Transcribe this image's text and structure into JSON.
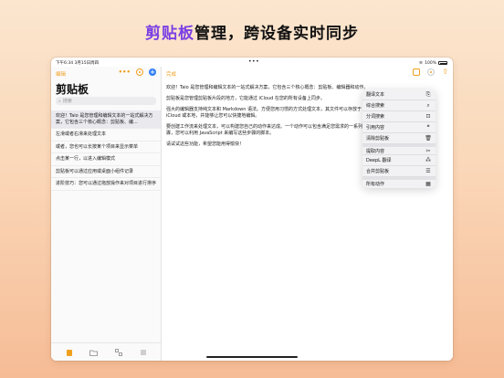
{
  "headline": {
    "highlight": "剪贴板",
    "rest": "管理，跨设备实时同步"
  },
  "status": {
    "time": "下午6:34  3月15日周四",
    "center": "•••",
    "battery": "100%"
  },
  "sidebar": {
    "edit": "编辑",
    "more": "•••",
    "add": "+",
    "title": "剪贴板",
    "search_placeholder": "搜索",
    "items": [
      {
        "text": "欢迎！Taio 是您管理和编辑文本的一站式解决方案，它包含三个核心概念：剪贴板、编..."
      },
      {
        "text": "左滑或者右滑来处理文本"
      },
      {
        "text": "或者，您也可以长按某个项目来显示菜单"
      },
      {
        "text": "点击某一行，以进入编辑模式"
      },
      {
        "text": "剪贴板可以通过应用或桌面小组件记录"
      },
      {
        "text": "进阶技巧：您可以通过拖放操作来对项目进行排序"
      }
    ]
  },
  "content": {
    "done": "完成",
    "paragraphs": [
      "欢迎！Taio 是您管理和编辑文本的一站式解决方案，它包含三个核心概念：剪贴板、编辑器和动作。",
      "剪贴板是您管理剪贴板片段的地方，它能通过 iCloud 在您的所有设备上同步。",
      "强大的编辑器支持纯文本和 Markdown 语法。方便您用习惯的方式处理文本，其文件可以存放于 iCloud 或本地，并能够让您可以快捷地编辑。",
      "要创建工作流来处理文本，可以构建您自己的动作来达成。一个动作可以包含满足您需求的一系列步骤，您可以利用 JavaScript 来编写这些步骤的脚本。",
      "请试试这些功能，希望您能用得愉快！"
    ]
  },
  "menu": {
    "items": [
      {
        "label": "翻译文本",
        "icon": "translate-icon",
        "glyph": "⎘"
      },
      {
        "label": "综合搜索",
        "icon": "search-icon",
        "glyph": "⌕"
      },
      {
        "label": "分词搜索",
        "icon": "split-search-icon",
        "glyph": "⊡"
      },
      {
        "label": "引用内容",
        "icon": "quote-icon",
        "glyph": "❝"
      },
      {
        "label": "清除剪贴板",
        "icon": "trash-icon",
        "glyph": "🗑"
      },
      {
        "label": "提取内容",
        "icon": "scissors-icon",
        "glyph": "✂"
      },
      {
        "label": "DeepL 翻译",
        "icon": "deepl-icon",
        "glyph": "⁂"
      },
      {
        "label": "合并剪贴板",
        "icon": "merge-icon",
        "glyph": "☰"
      },
      {
        "label": "所有动作",
        "icon": "grid-icon",
        "glyph": "▦"
      }
    ]
  },
  "colors": {
    "accent": "#f0a020",
    "headline_highlight": "#7b3fe4",
    "add_button": "#2f7cf6"
  }
}
